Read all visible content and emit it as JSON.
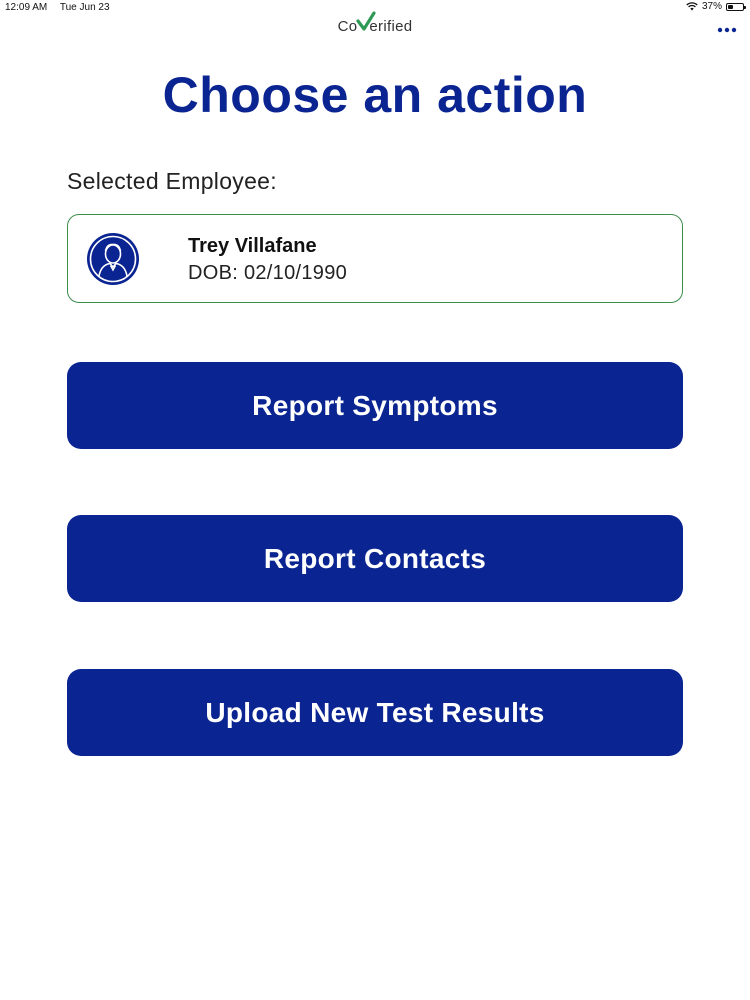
{
  "status_bar": {
    "time": "12:09 AM",
    "date": "Tue Jun 23",
    "battery_percent_label": "37%",
    "battery_level": 0.37
  },
  "header": {
    "logo_prefix": "Co",
    "logo_suffix": "erified",
    "logo_icon": "checkmark-v-icon",
    "more_icon": "more-dots-icon"
  },
  "main": {
    "title": "Choose an action",
    "selected_label": "Selected Employee:",
    "employee": {
      "name": "Trey Villafane",
      "dob": "DOB: 02/10/1990",
      "avatar_icon": "person-avatar-icon"
    },
    "actions": [
      {
        "label": "Report Symptoms"
      },
      {
        "label": "Report Contacts"
      },
      {
        "label": "Upload New Test Results"
      }
    ]
  },
  "colors": {
    "primary": "#0a2491",
    "card_border": "#3c8c4c",
    "logo_check": "#2f9a55"
  }
}
